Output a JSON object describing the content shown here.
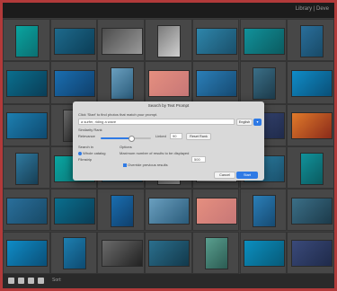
{
  "header": {
    "module_label": "Library | Deve"
  },
  "bottom_bar": {
    "sort_label": "Sort:"
  },
  "dialog": {
    "title": "Search by Text Prompt",
    "instruction": "Click 'Start' to find photos that match your prompt.",
    "prompt_value": "a surfer, riding a wave",
    "language": "English",
    "similarity_label": "Similarity Rank",
    "relevance_label": "Relevance",
    "linked_label": "Linked",
    "rank_value": "90",
    "reset_label": "Reset Rank",
    "slider_level_percent": 60,
    "search_in_label": "Search in",
    "whole_catalog_label": "Whole catalog",
    "filmstrip_label": "Filmstrip",
    "options_label": "Options",
    "options_note": "Maximum number of results to be displayed",
    "max_results_value": "500",
    "override_label": "Override previous results",
    "cancel_label": "Cancel",
    "start_label": "Start"
  },
  "colors": {
    "accent": "#2f7ae5",
    "frame": "#b23a3a"
  }
}
